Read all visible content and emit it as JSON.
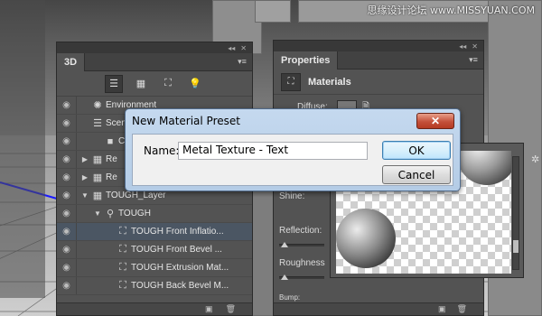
{
  "watermark": "思缘设计论坛 www.MISSYUAN.COM",
  "colors": {
    "panel_bg": "#535353",
    "dialog_frame": "#b4cce6",
    "selection": "#4b5663",
    "close_button": "#c4503a"
  },
  "panel3d": {
    "tab_label": "3D",
    "collapse_glyph": "◂◂",
    "close_glyph": "✕",
    "menu_icon": "panel-menu-icon",
    "filters": [
      {
        "icon": "whole-scene-icon",
        "glyph": "☰",
        "active": true
      },
      {
        "icon": "meshes-icon",
        "glyph": "▦",
        "active": false
      },
      {
        "icon": "materials-icon",
        "glyph": "⛶",
        "active": false
      },
      {
        "icon": "lights-icon",
        "glyph": "💡",
        "active": false
      }
    ],
    "rows": [
      {
        "label": "Environment",
        "icon": "environment-icon",
        "glyph": "✺",
        "expand": "",
        "indent": 0,
        "eye": true
      },
      {
        "label": "Scene",
        "icon": "scene-icon",
        "glyph": "☰",
        "expand": "",
        "indent": 0,
        "eye": true
      },
      {
        "label": "Cu",
        "icon": "camera-icon",
        "glyph": "■",
        "expand": "",
        "indent": 1,
        "eye": false
      },
      {
        "label": "Re",
        "icon": "mesh-icon",
        "glyph": "▦",
        "expand": "▶",
        "indent": 0,
        "eye": true
      },
      {
        "label": "Re",
        "icon": "mesh-icon",
        "glyph": "▦",
        "expand": "▶",
        "indent": 0,
        "eye": true
      },
      {
        "label": "TOUGH_Layer",
        "icon": "mesh-icon",
        "glyph": "▦",
        "expand": "▼",
        "indent": 0,
        "eye": true
      },
      {
        "label": "TOUGH",
        "icon": "mesh-icon",
        "glyph": "⚲",
        "expand": "▼",
        "indent": 1,
        "eye": true
      },
      {
        "label": "TOUGH Front Inflatio...",
        "icon": "material-icon",
        "glyph": "⛶",
        "expand": "",
        "indent": 2,
        "eye": false,
        "selected": true
      },
      {
        "label": "TOUGH Front Bevel ...",
        "icon": "material-icon",
        "glyph": "⛶",
        "expand": "",
        "indent": 2,
        "eye": false
      },
      {
        "label": "TOUGH Extrusion Mat...",
        "icon": "material-icon",
        "glyph": "⛶",
        "expand": "",
        "indent": 2,
        "eye": false
      },
      {
        "label": "TOUGH Back Bevel M...",
        "icon": "material-icon",
        "glyph": "⛶",
        "expand": "",
        "indent": 2,
        "eye": false
      }
    ],
    "bottom_icons": [
      {
        "icon": "new-icon",
        "glyph": "▣"
      },
      {
        "icon": "delete-icon",
        "glyph": "🗑"
      }
    ]
  },
  "properties": {
    "tab_label": "Properties",
    "collapse_glyph": "◂◂",
    "close_glyph": "✕",
    "header_icon": "materials-icon",
    "header_title": "Materials",
    "labels": {
      "diffuse": "Diffuse:",
      "shine": "Shine:",
      "reflection": "Reflection:",
      "roughness": "Roughness",
      "bump": "Bump:"
    },
    "bottom_icons": [
      {
        "icon": "new-icon",
        "glyph": "▣"
      },
      {
        "icon": "delete-icon",
        "glyph": "🗑"
      }
    ]
  },
  "picker": {
    "gear_icon": "gear-icon",
    "gear_glyph": "✲"
  },
  "dialog": {
    "title": "New Material Preset",
    "close_glyph": "✕",
    "name_label": "Name:",
    "name_value": "Metal Texture - Text",
    "ok_label": "OK",
    "cancel_label": "Cancel"
  }
}
